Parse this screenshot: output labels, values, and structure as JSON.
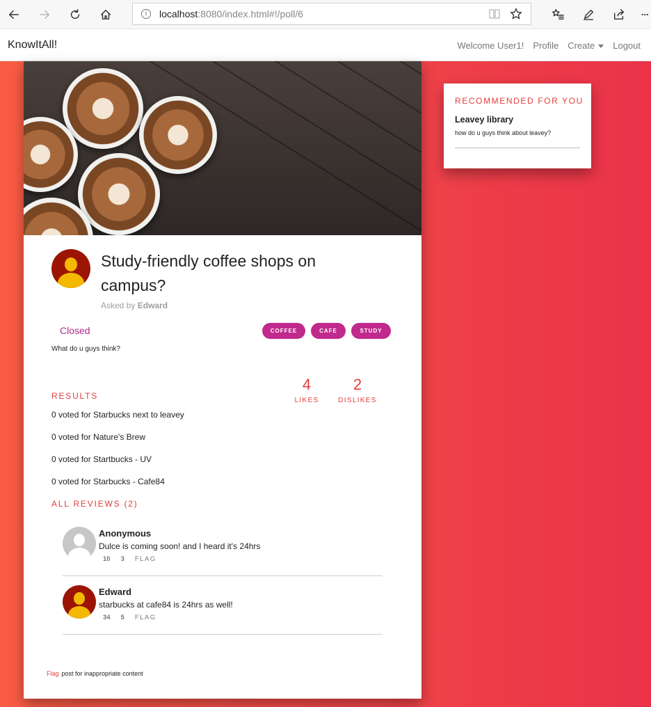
{
  "browser": {
    "url_host": "localhost",
    "url_rest": ":8080/index.html#!/poll/6"
  },
  "nav": {
    "brand": "KnowItAll!",
    "welcome": "Welcome User1!",
    "profile": "Profile",
    "create": "Create",
    "logout": "Logout"
  },
  "poll": {
    "title": "Study-friendly coffee shops on campus?",
    "asked_prefix": "Asked by",
    "author": "Edward",
    "status": "Closed",
    "tags": [
      "COFFEE",
      "CAFE",
      "STUDY"
    ],
    "description": "What do u guys think?",
    "likes": "4",
    "likes_label": "LIKES",
    "dislikes": "2",
    "dislikes_label": "DISLIKES",
    "results_heading": "RESULTS",
    "results": [
      "0 voted for Starbucks next to leavey",
      "0 voted for Nature's Brew",
      "0 voted for Startbucks - UV",
      "0 voted for Starbucks - Cafe84"
    ],
    "reviews_heading": "ALL REVIEWS (2)",
    "reviews": [
      {
        "name": "Anonymous",
        "text": "Dulce is coming soon! and I heard it's 24hrs",
        "up": "10",
        "down": "3",
        "flag": "FLAG"
      },
      {
        "name": "Edward",
        "text": "starbucks at cafe84 is 24hrs as well!",
        "up": "34",
        "down": "5",
        "flag": "FLAG"
      }
    ],
    "flag_link": "Flag",
    "flag_note": "post for inappropriate content"
  },
  "sidebar": {
    "heading": "RECOMMENDED FOR YOU",
    "title": "Leavey library",
    "desc": "how do u guys think about leavey?"
  },
  "colors": {
    "accent": "#e53b3b",
    "tag": "#c02a8c",
    "status": "#b42a8f",
    "avatar_bg": "#9b1404",
    "avatar_fg": "#f5b800"
  }
}
